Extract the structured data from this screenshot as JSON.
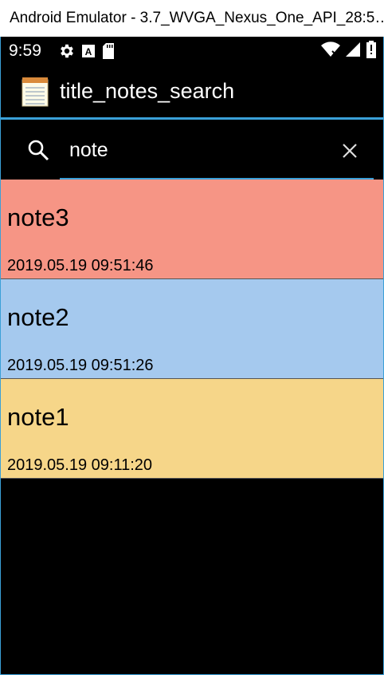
{
  "window": {
    "title": "Android Emulator - 3.7_WVGA_Nexus_One_API_28:5…"
  },
  "statusbar": {
    "time": "9:59",
    "left_icons": [
      "gear-icon",
      "a-box-icon",
      "sd-card-icon"
    ],
    "right_icons": [
      "wifi-icon",
      "signal-icon",
      "battery-icon"
    ]
  },
  "actionbar": {
    "title": "title_notes_search",
    "icon": "notepad-icon"
  },
  "search": {
    "value": "note",
    "accent_color": "#3aa0d8"
  },
  "notes": [
    {
      "title": "note3",
      "timestamp": "2019.05.19 09:51:46",
      "color": "#f69585"
    },
    {
      "title": "note2",
      "timestamp": "2019.05.19 09:51:26",
      "color": "#a5c9ee"
    },
    {
      "title": "note1",
      "timestamp": "2019.05.19 09:11:20",
      "color": "#f6d689"
    }
  ]
}
